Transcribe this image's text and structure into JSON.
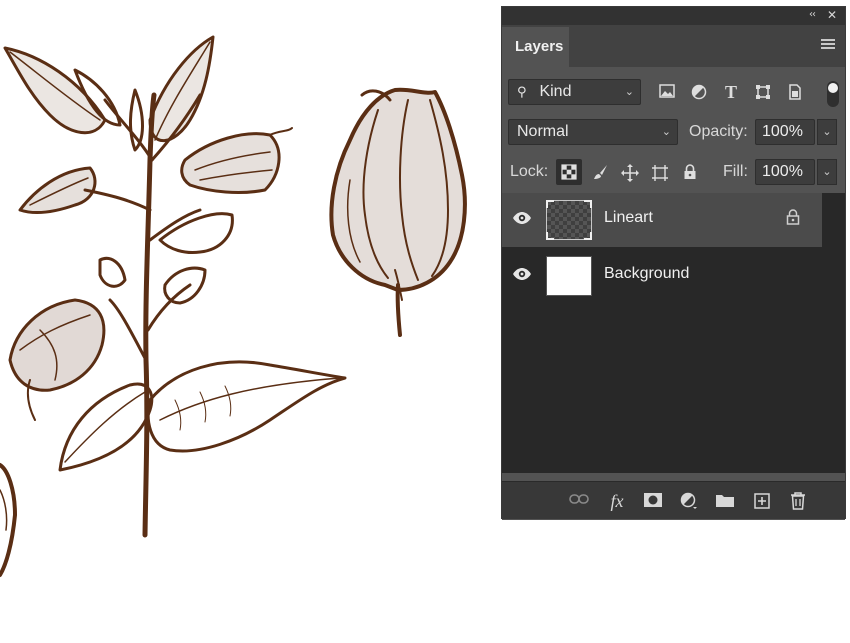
{
  "window": {
    "collapse_glyph": "‹‹",
    "close_glyph": "✕"
  },
  "panel": {
    "tab_label": "Layers",
    "menu_icon": "hamburger-menu-icon"
  },
  "filter": {
    "kind_label": "Kind",
    "kind_icon": "search-icon",
    "icons": [
      "image-filter-icon",
      "adjustment-filter-icon",
      "type-filter-icon",
      "shape-filter-icon",
      "smart-object-filter-icon"
    ],
    "toggle_on": true
  },
  "blend": {
    "mode": "Normal",
    "opacity_label": "Opacity:",
    "opacity_value": "100%"
  },
  "lock": {
    "label": "Lock:",
    "icons": [
      "lock-transparent-pixels-icon",
      "lock-image-pixels-icon",
      "lock-position-icon",
      "prevent-autonest-icon",
      "lock-all-icon"
    ],
    "fill_label": "Fill:",
    "fill_value": "100%"
  },
  "layers": [
    {
      "name": "Lineart",
      "visible": true,
      "selected": true,
      "locked": true,
      "thumbnail": "transparent-checker"
    },
    {
      "name": "Background",
      "visible": true,
      "selected": false,
      "locked": false,
      "thumbnail": "white"
    }
  ],
  "footer": {
    "icons": [
      "link-layers-icon",
      "fx-icon",
      "add-mask-icon",
      "new-adjustment-layer-icon",
      "new-group-folder-icon",
      "new-layer-icon",
      "delete-layer-icon"
    ],
    "fx_label": "fx"
  },
  "colors": {
    "ink": "#5a2e14",
    "panel_bg": "#535353",
    "layers_bg": "#282828",
    "selected_row": "#4b4b4b"
  }
}
